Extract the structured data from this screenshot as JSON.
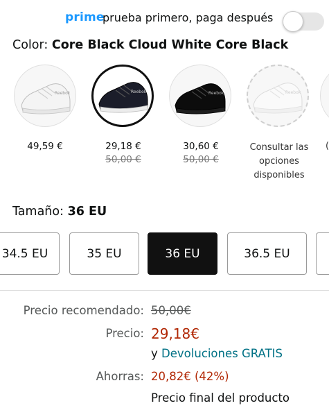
{
  "prime": {
    "word": "prime",
    "text": "prueba primero, paga después",
    "toggle_on": false
  },
  "color": {
    "label": "Color:",
    "value": "Core Black Cloud White Core Black"
  },
  "swatches": [
    {
      "price": "49,59 €",
      "was": "",
      "shoe_color": "#f4f4f4",
      "selected": false
    },
    {
      "price": "29,18 €",
      "was": "50,00 €",
      "shoe_color": "#1b1d2a",
      "selected": true
    },
    {
      "price": "30,60 €",
      "was": "50,00 €",
      "shoe_color": "#0c0c0c",
      "selected": false
    },
    {
      "price": "",
      "was": "",
      "consult": "Consultar las opciones disponibles",
      "shoe_color": "#fafafa",
      "selected": false
    }
  ],
  "next_swatch_partial_char": "(",
  "size": {
    "label": "Tamaño:",
    "value": "36 EU",
    "options": [
      "34.5 EU",
      "35 EU",
      "36 EU",
      "36.5 EU"
    ],
    "selected": "36 EU"
  },
  "pricing": {
    "recommended_label": "Precio recomendado:",
    "recommended_value": "50,00€",
    "price_label": "Precio:",
    "price_value": "29,18€",
    "returns_prefix": "y",
    "returns_link": "Devoluciones GRATIS",
    "savings_label": "Ahorras:",
    "savings_value": "20,82€ (42%)",
    "final_note": "Precio final del producto"
  },
  "colors": {
    "prime_blue": "#1a98ff",
    "price_red": "#b12704",
    "link_teal": "#007185",
    "selected_bg": "#111111"
  }
}
